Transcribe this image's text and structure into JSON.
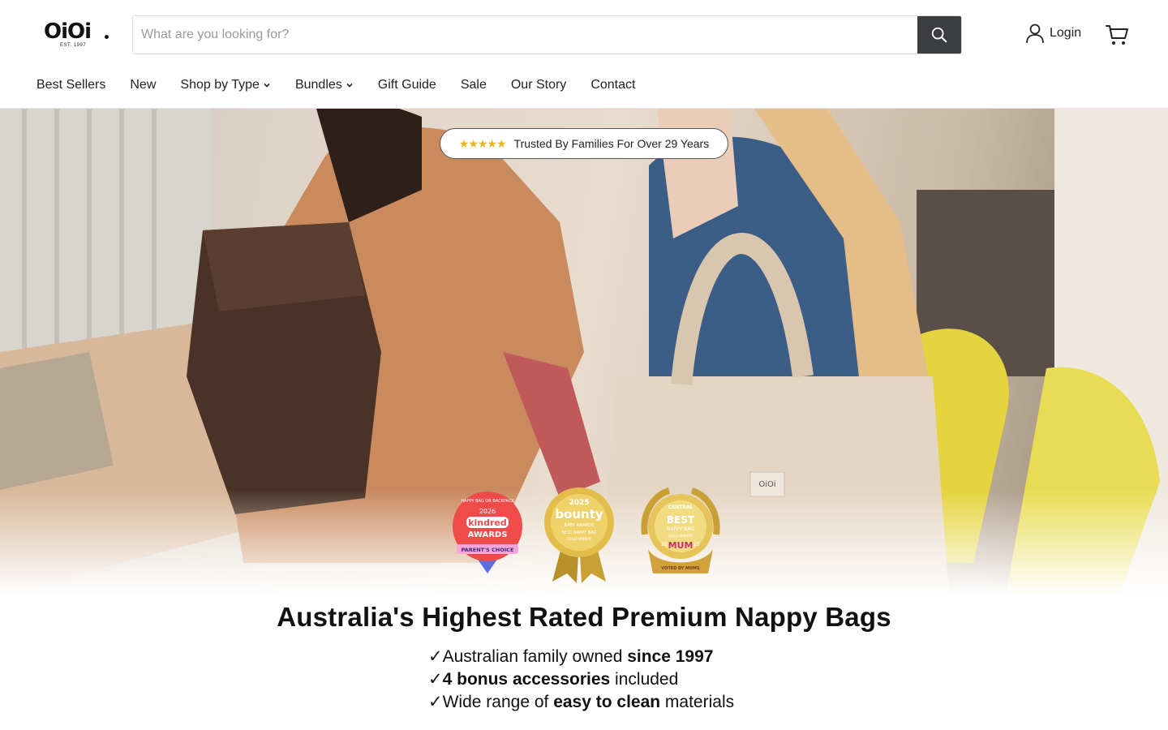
{
  "brand": {
    "name": "OiOi",
    "est": "EST. 1997"
  },
  "search": {
    "placeholder": "What are you looking for?"
  },
  "header": {
    "login_label": "Login"
  },
  "nav": {
    "items": [
      {
        "label": "Best Sellers"
      },
      {
        "label": "New"
      },
      {
        "label": "Shop by Type"
      },
      {
        "label": "Bundles"
      },
      {
        "label": "Gift Guide"
      },
      {
        "label": "Sale"
      },
      {
        "label": "Our Story"
      },
      {
        "label": "Contact"
      }
    ]
  },
  "hero": {
    "trust_stars": "★★★★★",
    "trust_text": "Trusted By Families For Over 29 Years",
    "badges": [
      {
        "top": "HAPPY BAG OR BACKPACK",
        "year": "2026",
        "brand": "kindred",
        "title": "AWARDS",
        "ribbon": "PARENT'S CHOICE"
      },
      {
        "year": "2025",
        "brand": "bounty",
        "sub": "BABY AWARDS",
        "title": "BEST NAPPY BAG",
        "ribbon": "GOLD WINNER"
      },
      {
        "top": "CENTRAL",
        "title": "BEST",
        "sub": "NAPPY BAG",
        "ribbon": "GOLD WINNER",
        "brand": "MUM",
        "year_left": "20",
        "year_right": "25",
        "bottom": "VOTED BY MUMS"
      }
    ]
  },
  "content": {
    "headline": "Australia's Highest Rated Premium Nappy Bags",
    "bullets": [
      {
        "check": "✓",
        "pre": "Australian family owned ",
        "bold": "since 1997",
        "post": ""
      },
      {
        "check": "✓",
        "pre": "",
        "bold": "4 bonus accessories",
        "post": " included"
      },
      {
        "check": "✓",
        "pre": "Wide range of ",
        "bold": "easy to clean",
        "post": " materials"
      }
    ]
  },
  "colors": {
    "search_button": "#3b3d40",
    "stars": "#e8b523",
    "kindred_red": "#f04b4b",
    "gold": "#d9a733"
  },
  "icons": {
    "search": "search-icon",
    "user": "user-icon",
    "cart": "cart-icon",
    "chevron": "chevron-down-icon"
  }
}
